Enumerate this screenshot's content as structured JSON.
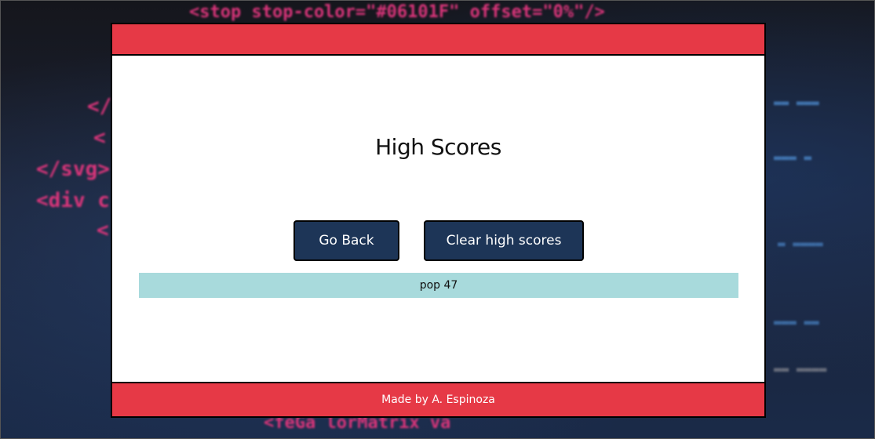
{
  "page": {
    "title": "High Scores",
    "footer_text": "Made by A. Espinoza"
  },
  "buttons": {
    "go_back_label": "Go Back",
    "clear_label": "Clear high scores"
  },
  "scores": [
    {
      "entry": "pop 47"
    }
  ],
  "background_code": {
    "line_top": "<stop stop-color=\"#06101F\" offset=\"0%\"/>",
    "line_bottom": "<feGa   lorMatrix va",
    "left_1": "</",
    "left_2": "<",
    "left_3": "</svg>",
    "left_4": "<div c",
    "left_5": "<"
  },
  "colors": {
    "accent_red": "#e63946",
    "button_navy": "#1d3557",
    "score_row": "#a8dadc"
  }
}
